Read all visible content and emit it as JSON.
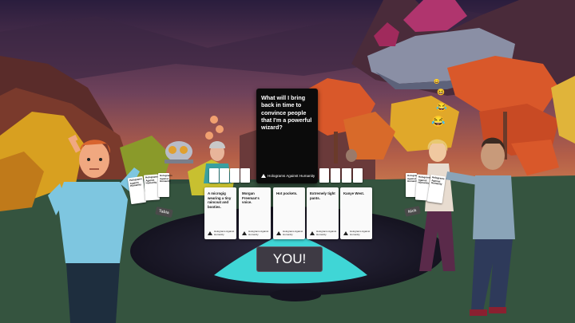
{
  "game": {
    "black_card": {
      "question": "What will I bring back in time to convince people that I'm a powerful wizard?",
      "brand": "Holograms Against Humanity"
    },
    "white_cards": [
      {
        "answer": "A microgig wearing a tiny raincoat and booties.",
        "brand": "Holograms Against Humanity"
      },
      {
        "answer": "Morgan Freeman's voice.",
        "brand": "Holograms Against Humanity"
      },
      {
        "answer": "Hot pockets.",
        "brand": "Holograms Against Humanity"
      },
      {
        "answer": "Extremely tight pants.",
        "brand": "Holograms Against Humanity"
      },
      {
        "answer": "Kanye West.",
        "brand": "Holograms Against Humanity"
      }
    ],
    "left_hand_cards": [
      "Holograms Against Humanity",
      "Holograms Against Humanity",
      "Holograms Against Humanity"
    ],
    "right_hand_cards": [
      "Holograms Against Humanity",
      "Holograms Against Humanity",
      "Holograms Against Humanity"
    ],
    "player_plates": {
      "left": "Tabia",
      "right": "Nick"
    },
    "you_button": "YOU!"
  },
  "colors": {
    "sky_top": "#2c1e3e",
    "sky_mid": "#7b4a5e",
    "sky_glow": "#c96a4a",
    "table": "#1c1a2a",
    "table_glow": "#3fd6d6",
    "tree_orange": "#d9582a",
    "tree_yellow": "#d8a020"
  }
}
